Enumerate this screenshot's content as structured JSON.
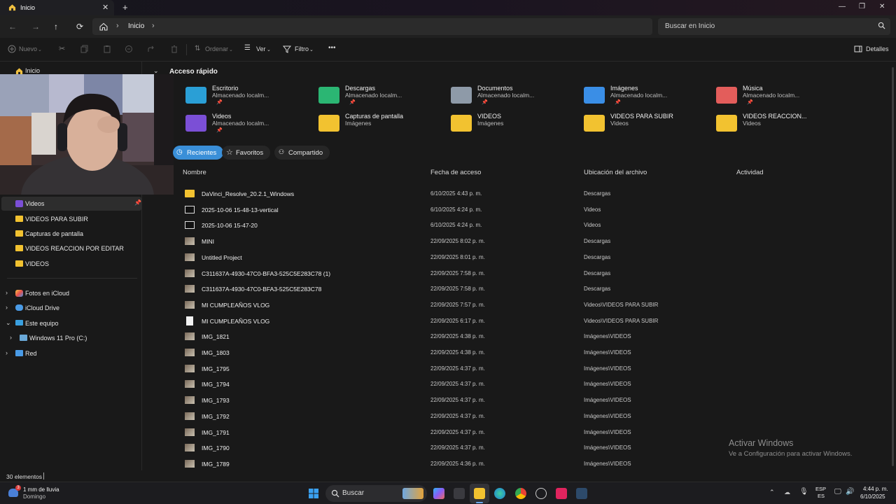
{
  "window": {
    "tab_title": "Inicio",
    "tab_close": "✕",
    "new_tab": "+",
    "minimize": "—",
    "maximize": "❐",
    "close": "✕"
  },
  "nav": {
    "back": "←",
    "forward": "→",
    "up": "↑",
    "refresh": "⟳",
    "breadcrumb": "Inicio",
    "chevron": "›",
    "search_placeholder": "Buscar en Inicio"
  },
  "toolbar": {
    "new_label": "Nuevo",
    "sort_label": "Ordenar",
    "view_label": "Ver",
    "filter_label": "Filtro",
    "more_label": "•••",
    "details_label": "Detalles"
  },
  "sidebar": {
    "home_label": "Inicio",
    "pinned": [
      {
        "label": "Videos"
      },
      {
        "label": "VIDEOS PARA SUBIR"
      },
      {
        "label": "Capturas de pantalla"
      },
      {
        "label": "VIDEOS REACCION POR EDITAR"
      },
      {
        "label": "VIDEOS"
      }
    ],
    "tree": [
      {
        "label": "Fotos en iCloud"
      },
      {
        "label": "iCloud Drive"
      },
      {
        "label": "Este equipo"
      },
      {
        "label": "Windows 11 Pro (C:)"
      },
      {
        "label": "Red"
      }
    ]
  },
  "quick_access": {
    "header": "Acceso rápido",
    "items": [
      {
        "name": "Escritorio",
        "sub": "Almacenado localm...",
        "color": "#2a9fd6"
      },
      {
        "name": "Descargas",
        "sub": "Almacenado localm...",
        "color": "#2bb673"
      },
      {
        "name": "Documentos",
        "sub": "Almacenado localm...",
        "color": "#8e9aa8"
      },
      {
        "name": "Imágenes",
        "sub": "Almacenado localm...",
        "color": "#3a8ee6"
      },
      {
        "name": "Música",
        "sub": "Almacenado localm...",
        "color": "#e35d5b"
      },
      {
        "name": "Videos",
        "sub": "Almacenado localm...",
        "color": "#7b4fd6"
      },
      {
        "name": "Capturas de pantalla",
        "sub": "Imágenes",
        "color": "#f2c230"
      },
      {
        "name": "VIDEOS",
        "sub": "Imágenes",
        "color": "#f2c230"
      },
      {
        "name": "VIDEOS PARA SUBIR",
        "sub": "Videos",
        "color": "#f2c230"
      },
      {
        "name": "VIDEOS REACCION...",
        "sub": "Videos",
        "color": "#f2c230"
      }
    ]
  },
  "tabs": {
    "recent": "Recientes",
    "favorites": "Favoritos",
    "shared": "Compartido"
  },
  "columns": {
    "name": "Nombre",
    "date": "Fecha de acceso",
    "location": "Ubicación del archivo",
    "activity": "Actividad"
  },
  "files": [
    {
      "name": "DaVinci_Resolve_20.2.1_Windows",
      "date": "6/10/2025 4:43 p. m.",
      "loc": "Descargas",
      "kind": "folder"
    },
    {
      "name": "2025-10-06 15-48-13-vertical",
      "date": "6/10/2025 4:24 p. m.",
      "loc": "Videos",
      "kind": "video"
    },
    {
      "name": "2025-10-06 15-47-20",
      "date": "6/10/2025 4:24 p. m.",
      "loc": "Videos",
      "kind": "video"
    },
    {
      "name": "MINI",
      "date": "22/09/2025 8:02 p. m.",
      "loc": "Descargas",
      "kind": "image"
    },
    {
      "name": "Untitled Project",
      "date": "22/09/2025 8:01 p. m.",
      "loc": "Descargas",
      "kind": "image"
    },
    {
      "name": "C311637A-4930-47C0-BFA3-525C5E283C78 (1)",
      "date": "22/09/2025 7:58 p. m.",
      "loc": "Descargas",
      "kind": "image"
    },
    {
      "name": "C311637A-4930-47C0-BFA3-525C5E283C78",
      "date": "22/09/2025 7:58 p. m.",
      "loc": "Descargas",
      "kind": "image"
    },
    {
      "name": "MI CUMPLEAÑOS VLOG",
      "date": "22/09/2025 7:57 p. m.",
      "loc": "Videos\\VIDEOS PARA SUBIR",
      "kind": "image"
    },
    {
      "name": "MI CUMPLEAÑOS VLOG",
      "date": "22/09/2025 6:17 p. m.",
      "loc": "Videos\\VIDEOS PARA SUBIR",
      "kind": "doc"
    },
    {
      "name": "IMG_1821",
      "date": "22/09/2025 4:38 p. m.",
      "loc": "Imágenes\\VIDEOS",
      "kind": "image"
    },
    {
      "name": "IMG_1803",
      "date": "22/09/2025 4:38 p. m.",
      "loc": "Imágenes\\VIDEOS",
      "kind": "image"
    },
    {
      "name": "IMG_1795",
      "date": "22/09/2025 4:37 p. m.",
      "loc": "Imágenes\\VIDEOS",
      "kind": "image"
    },
    {
      "name": "IMG_1794",
      "date": "22/09/2025 4:37 p. m.",
      "loc": "Imágenes\\VIDEOS",
      "kind": "image"
    },
    {
      "name": "IMG_1793",
      "date": "22/09/2025 4:37 p. m.",
      "loc": "Imágenes\\VIDEOS",
      "kind": "image"
    },
    {
      "name": "IMG_1792",
      "date": "22/09/2025 4:37 p. m.",
      "loc": "Imágenes\\VIDEOS",
      "kind": "image"
    },
    {
      "name": "IMG_1791",
      "date": "22/09/2025 4:37 p. m.",
      "loc": "Imágenes\\VIDEOS",
      "kind": "image"
    },
    {
      "name": "IMG_1790",
      "date": "22/09/2025 4:37 p. m.",
      "loc": "Imágenes\\VIDEOS",
      "kind": "image"
    },
    {
      "name": "IMG_1789",
      "date": "22/09/2025 4:36 p. m.",
      "loc": "Imágenes\\VIDEOS",
      "kind": "image"
    }
  ],
  "status": {
    "count": "30 elementos"
  },
  "watermark": {
    "line1": "Activar Windows",
    "line2": "Ve a Configuración para activar Windows."
  },
  "taskbar": {
    "weather_temp": "1 mm de lluvia",
    "weather_day": "Domingo",
    "weather_badge": "3",
    "search_label": "Buscar",
    "lang_1": "ESP",
    "lang_2": "ES",
    "time": "4:44 p. m.",
    "date": "6/10/2025"
  }
}
